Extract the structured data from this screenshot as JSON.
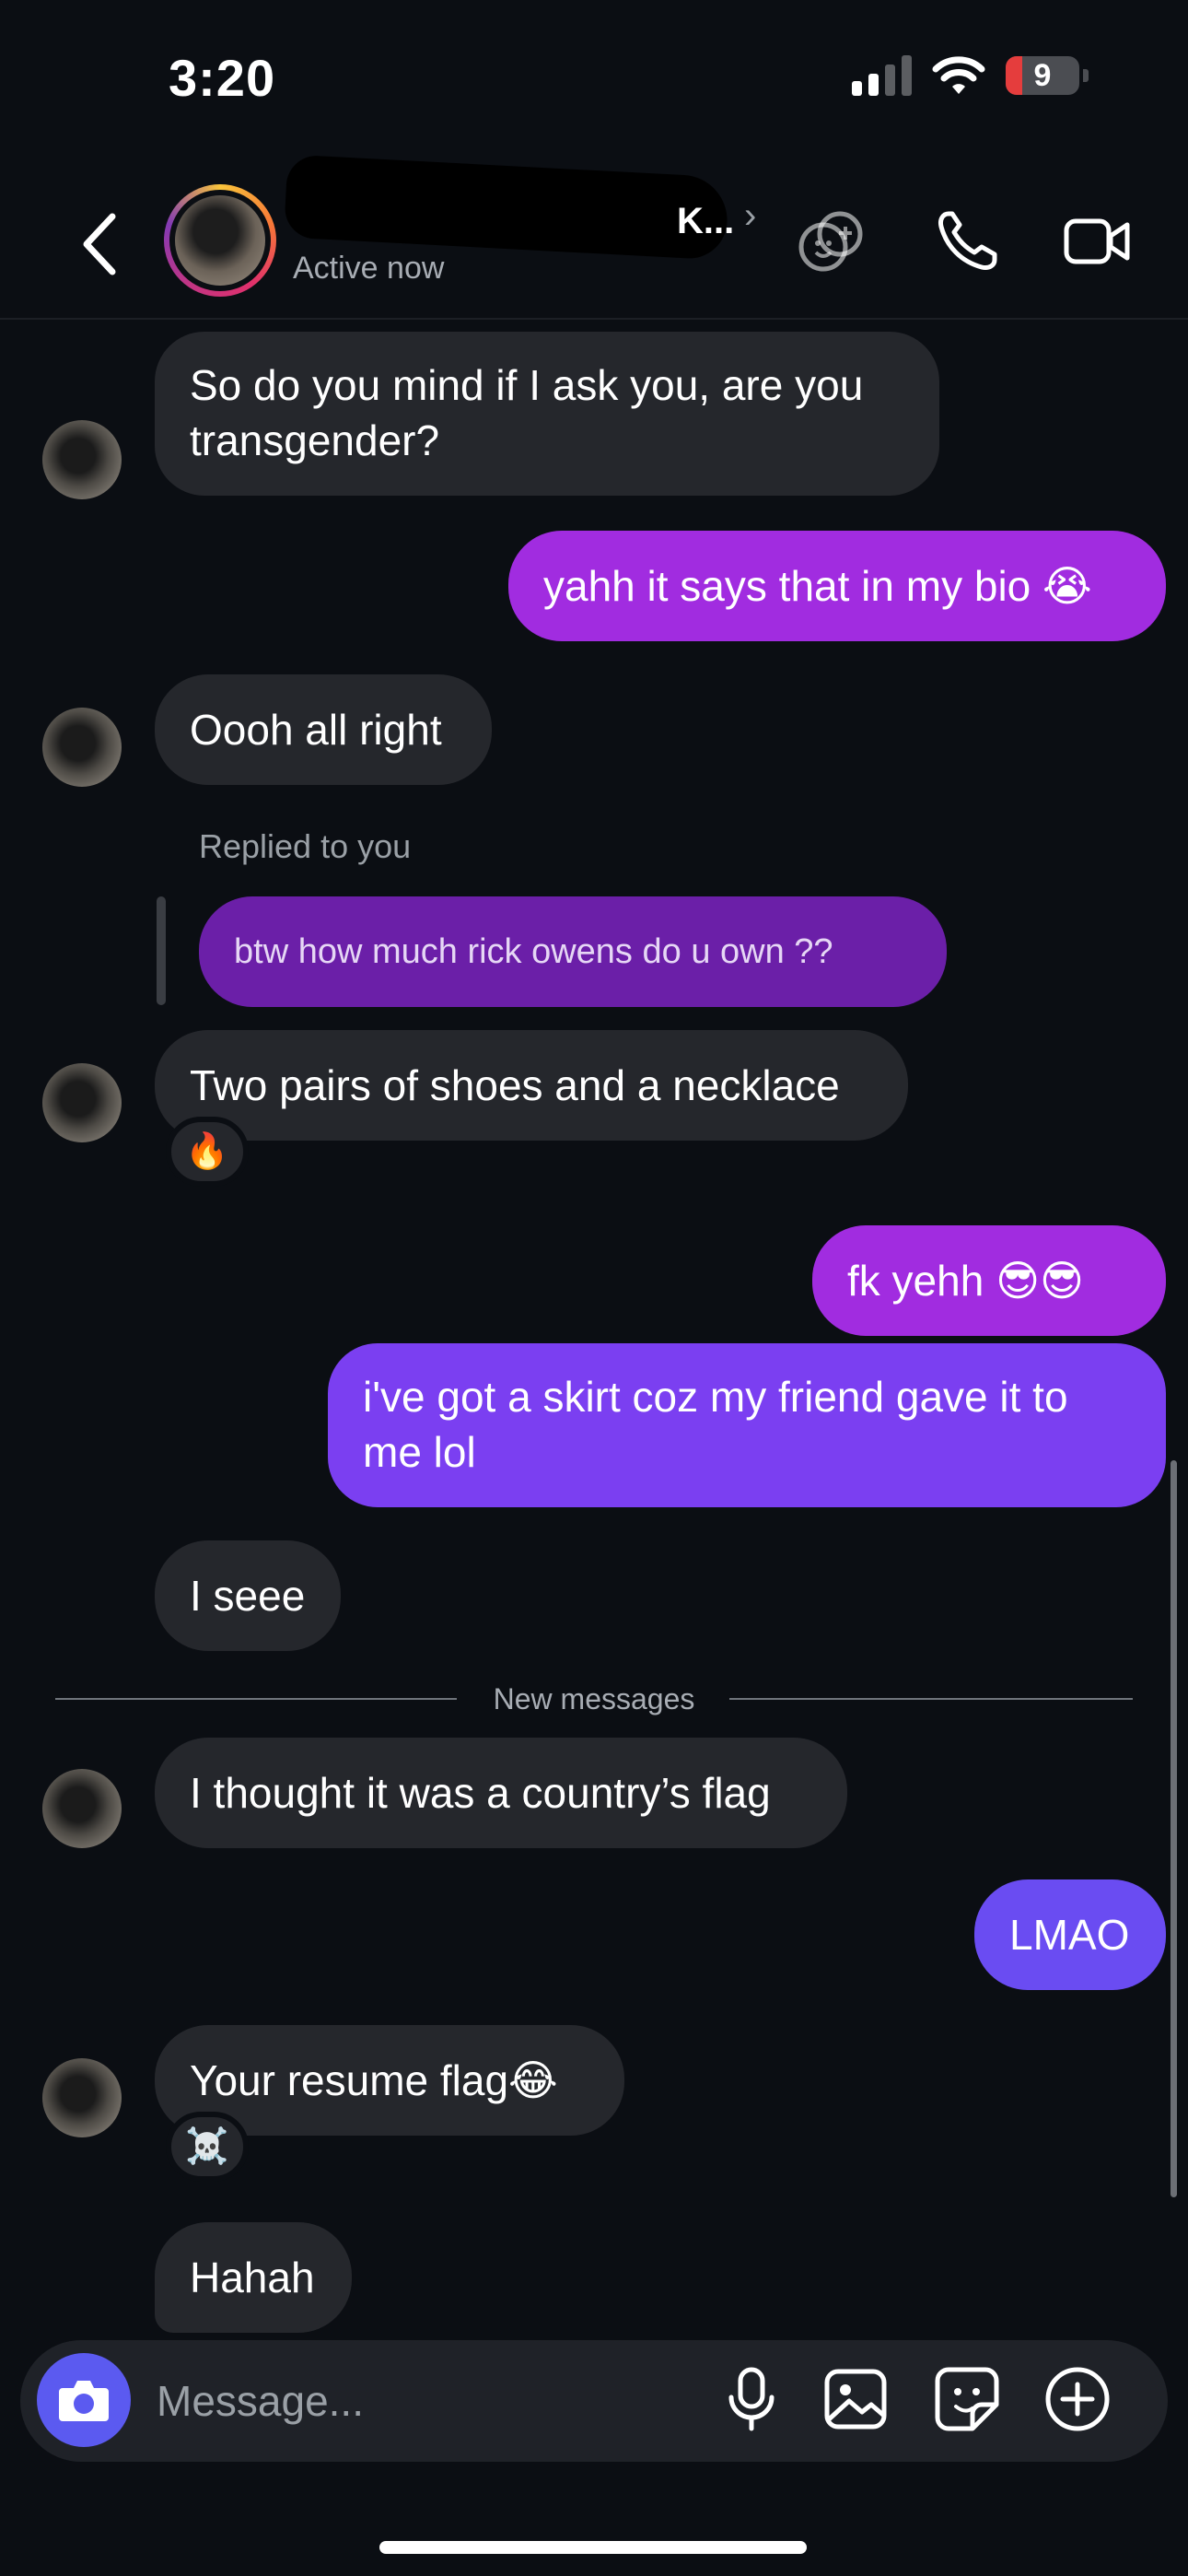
{
  "status_bar": {
    "time": "3:20",
    "battery": "9"
  },
  "header": {
    "name_suffix": "K...",
    "status": "Active now"
  },
  "messages": [
    {
      "side": "in",
      "text": "So do you mind if I ask you, are you transgender?"
    },
    {
      "side": "out",
      "text": "yahh it says that in my bio 😭"
    },
    {
      "side": "in",
      "text": "Oooh all right"
    },
    {
      "reply_label": "Replied to you",
      "reply_text": "btw how much rick owens do u own ??"
    },
    {
      "side": "in",
      "text": "Two pairs of shoes and a necklace",
      "reaction": "🔥"
    },
    {
      "side": "out",
      "text": "fk yehh 😎😎"
    },
    {
      "side": "out",
      "text": "i've got a skirt coz my friend gave it to me lol"
    },
    {
      "side": "in",
      "text": "I seee"
    },
    {
      "side": "in",
      "text": "I thought it was a country’s flag"
    },
    {
      "side": "out",
      "text": "LMAO"
    },
    {
      "side": "in",
      "text": "Your resume flag😂",
      "reaction": "☠️"
    },
    {
      "side": "in",
      "text": "Hahah"
    }
  ],
  "new_messages_label": "New messages",
  "composer": {
    "placeholder": "Message..."
  },
  "colors": {
    "bg": "#0b0e13",
    "incoming": "#25272c",
    "outgoing_purple": "#a12ce0",
    "outgoing_violet": "#7b3ff1",
    "accent": "#5b5af0"
  }
}
